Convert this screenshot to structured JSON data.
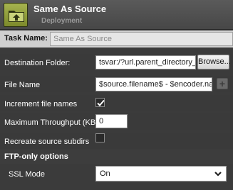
{
  "header": {
    "title": "Same As Source",
    "subtitle": "Deployment",
    "icon": "folder-upload-icon",
    "accent": "#8e9b37"
  },
  "task_name": {
    "label": "Task Name:",
    "value": "Same As Source"
  },
  "destination_folder": {
    "label": "Destination Folder:",
    "value": "tsvar:/?url.parent_directory_url",
    "browse_label": "Browse..."
  },
  "file_name": {
    "label": "File Name",
    "value": "$source.filename$ - $encoder.nam",
    "add_icon": "plus-icon"
  },
  "increment_file_names": {
    "label": "Increment file names",
    "checked": true
  },
  "maximum_throughput": {
    "label": "Maximum Throughput (KB)",
    "value": "0"
  },
  "recreate_source_subdirs": {
    "label": "Recreate source subdirs",
    "checked": false
  },
  "ftp_section": {
    "label": "FTP-only options"
  },
  "ssl_mode": {
    "label": "SSL Mode",
    "selected": "On"
  }
}
